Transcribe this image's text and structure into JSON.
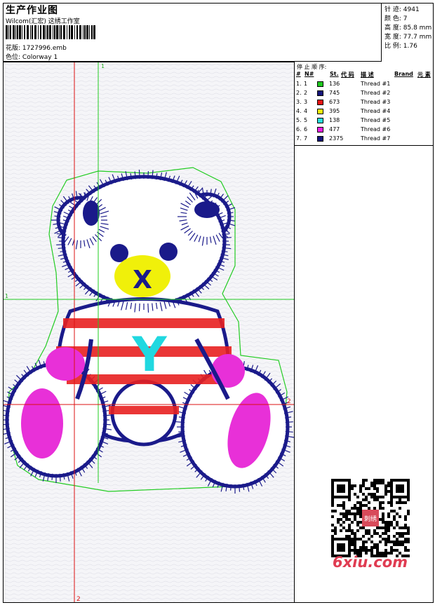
{
  "header": {
    "title": "生产作业图",
    "company": "Wilcom(汇宏) 这绣工作室",
    "pattern_label": "花版:",
    "pattern_value": "1727996.emb",
    "colorway_label": "色位:",
    "colorway_value": "Colorway 1"
  },
  "stats": [
    {
      "label": "针 迹:",
      "value": "4941"
    },
    {
      "label": "颜 色:",
      "value": "7"
    },
    {
      "label": "高 度:",
      "value": "85.8 mm"
    },
    {
      "label": "宽 度:",
      "value": "77.7 mm"
    },
    {
      "label": "比 例:",
      "value": "1.76"
    }
  ],
  "stop_sequence": {
    "title": "停 止 顺 序:",
    "headers": {
      "num": "#",
      "n": "N#",
      "st": "St.",
      "code": "代 码",
      "desc": "描 述",
      "brand": "Brand",
      "element": "元 素"
    },
    "rows": [
      {
        "num": "1.",
        "n": "1",
        "color": "#1ec81e",
        "st": "136",
        "desc": "Thread #1"
      },
      {
        "num": "2.",
        "n": "2",
        "color": "#14147a",
        "st": "745",
        "desc": "Thread #2"
      },
      {
        "num": "3.",
        "n": "3",
        "color": "#e81414",
        "st": "673",
        "desc": "Thread #3"
      },
      {
        "num": "4.",
        "n": "4",
        "color": "#f2f20a",
        "st": "395",
        "desc": "Thread #4"
      },
      {
        "num": "5.",
        "n": "5",
        "color": "#28e0e0",
        "st": "138",
        "desc": "Thread #5"
      },
      {
        "num": "6.",
        "n": "6",
        "color": "#ee1ee6",
        "st": "477",
        "desc": "Thread #6"
      },
      {
        "num": "7.",
        "n": "7",
        "color": "#14147a",
        "st": "2375",
        "desc": "Thread #7"
      }
    ]
  },
  "guides": {
    "v1_label": "1",
    "v2_label": "2",
    "h1_label": "1",
    "h2_label": "2",
    "green": "#22cc22",
    "red": "#dd1111"
  },
  "design": {
    "letter_y": "Y",
    "letter_k": "X",
    "outline": "#1a1a8a",
    "stripe": "#e82020",
    "pink": "#e830d8",
    "yellow": "#f0f00a",
    "cyan": "#20d8e0",
    "border": "#22cc22"
  },
  "watermark": "6xiu.com",
  "qr_badge": "刺绣"
}
